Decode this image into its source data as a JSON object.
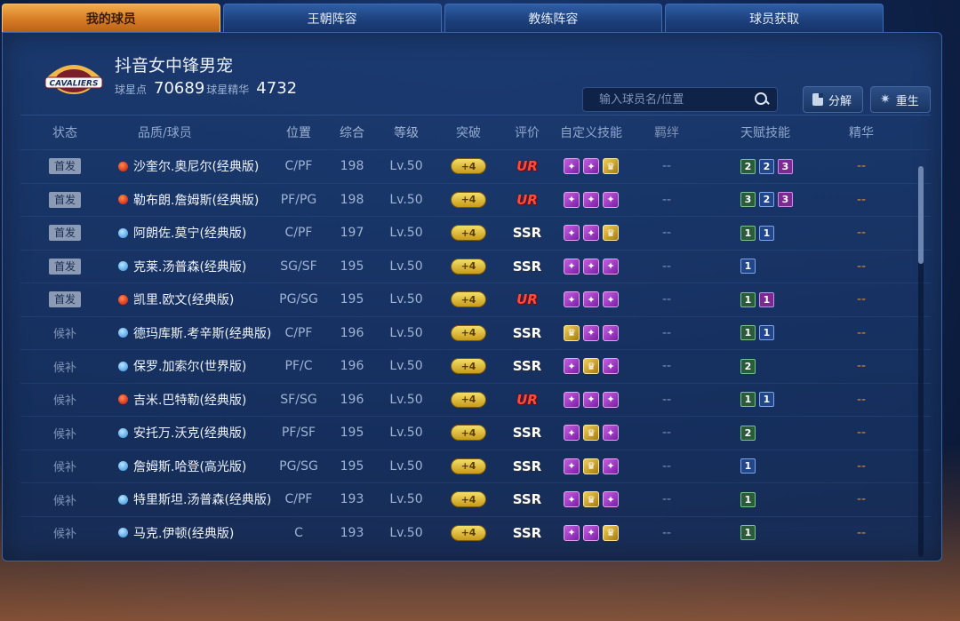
{
  "tabs": [
    {
      "label": "我的球员",
      "active": true
    },
    {
      "label": "王朝阵容",
      "active": false
    },
    {
      "label": "教练阵容",
      "active": false
    },
    {
      "label": "球员获取",
      "active": false
    }
  ],
  "team": {
    "logo_text": "CAVALIERS",
    "name": "抖音女中锋男宠",
    "points_label": "球星点",
    "points_value": "70689",
    "essence_label": "球星精华",
    "essence_value": "4732"
  },
  "search": {
    "placeholder": "输入球员名/位置"
  },
  "actions": {
    "decompose": "分解",
    "rebirth": "重生"
  },
  "columns": {
    "status": "状态",
    "player": "品质/球员",
    "position": "位置",
    "overall": "综合",
    "level": "等级",
    "breakthrough": "突破",
    "grade": "评价",
    "custom_skills": "自定义技能",
    "bond": "羁绊",
    "talent": "天赋技能",
    "essence": "精华"
  },
  "colors": {
    "active_tab": "#e08a2e",
    "ur_grade": "#ff4a3a",
    "essence": "#e28c2f"
  },
  "rows": [
    {
      "status": "首发",
      "starter": true,
      "rarity": "UR",
      "name": "沙奎尔.奥尼尔(经典版)",
      "position": "C/PF",
      "overall": "198",
      "level": "Lv.50",
      "breakthrough": "+4",
      "grade": "UR",
      "skills": [
        "purple",
        "purple",
        "gold"
      ],
      "bond": "--",
      "talent": [
        {
          "v": "2",
          "c": "green"
        },
        {
          "v": "2",
          "c": "blue"
        },
        {
          "v": "3",
          "c": "purple"
        }
      ],
      "essence": "--"
    },
    {
      "status": "首发",
      "starter": true,
      "rarity": "UR",
      "name": "勒布朗.詹姆斯(经典版)",
      "position": "PF/PG",
      "overall": "198",
      "level": "Lv.50",
      "breakthrough": "+4",
      "grade": "UR",
      "skills": [
        "purple",
        "purple",
        "purple"
      ],
      "bond": "--",
      "talent": [
        {
          "v": "3",
          "c": "green"
        },
        {
          "v": "2",
          "c": "blue"
        },
        {
          "v": "3",
          "c": "purple"
        }
      ],
      "essence": "--"
    },
    {
      "status": "首发",
      "starter": true,
      "rarity": "SSR",
      "name": "阿朗佐.莫宁(经典版)",
      "position": "C/PF",
      "overall": "197",
      "level": "Lv.50",
      "breakthrough": "+4",
      "grade": "SSR",
      "skills": [
        "purple",
        "purple",
        "gold"
      ],
      "bond": "--",
      "talent": [
        {
          "v": "1",
          "c": "green"
        },
        {
          "v": "1",
          "c": "blue"
        }
      ],
      "essence": "--"
    },
    {
      "status": "首发",
      "starter": true,
      "rarity": "SSR",
      "name": "克莱.汤普森(经典版)",
      "position": "SG/SF",
      "overall": "195",
      "level": "Lv.50",
      "breakthrough": "+4",
      "grade": "SSR",
      "skills": [
        "purple",
        "purple",
        "purple"
      ],
      "bond": "--",
      "talent": [
        {
          "v": "1",
          "c": "blue"
        }
      ],
      "essence": "--"
    },
    {
      "status": "首发",
      "starter": true,
      "rarity": "UR",
      "name": "凯里.欧文(经典版)",
      "position": "PG/SG",
      "overall": "195",
      "level": "Lv.50",
      "breakthrough": "+4",
      "grade": "UR",
      "skills": [
        "purple",
        "purple",
        "purple"
      ],
      "bond": "--",
      "talent": [
        {
          "v": "1",
          "c": "green"
        },
        {
          "v": "1",
          "c": "purple"
        }
      ],
      "essence": "--"
    },
    {
      "status": "候补",
      "starter": false,
      "rarity": "SSR",
      "name": "德玛库斯.考辛斯(经典版)",
      "position": "C/PF",
      "overall": "196",
      "level": "Lv.50",
      "breakthrough": "+4",
      "grade": "SSR",
      "skills": [
        "gold",
        "purple",
        "purple"
      ],
      "bond": "--",
      "talent": [
        {
          "v": "1",
          "c": "green"
        },
        {
          "v": "1",
          "c": "blue"
        }
      ],
      "essence": "--"
    },
    {
      "status": "候补",
      "starter": false,
      "rarity": "SSR",
      "name": "保罗.加索尔(世界版)",
      "position": "PF/C",
      "overall": "196",
      "level": "Lv.50",
      "breakthrough": "+4",
      "grade": "SSR",
      "skills": [
        "purple",
        "gold",
        "purple"
      ],
      "bond": "--",
      "talent": [
        {
          "v": "2",
          "c": "green"
        }
      ],
      "essence": "--"
    },
    {
      "status": "候补",
      "starter": false,
      "rarity": "UR",
      "name": "吉米.巴特勒(经典版)",
      "position": "SF/SG",
      "overall": "196",
      "level": "Lv.50",
      "breakthrough": "+4",
      "grade": "UR",
      "skills": [
        "purple",
        "purple",
        "purple"
      ],
      "bond": "--",
      "talent": [
        {
          "v": "1",
          "c": "green"
        },
        {
          "v": "1",
          "c": "blue"
        }
      ],
      "essence": "--"
    },
    {
      "status": "候补",
      "starter": false,
      "rarity": "SSR",
      "name": "安托万.沃克(经典版)",
      "position": "PF/SF",
      "overall": "195",
      "level": "Lv.50",
      "breakthrough": "+4",
      "grade": "SSR",
      "skills": [
        "purple",
        "gold",
        "purple"
      ],
      "bond": "--",
      "talent": [
        {
          "v": "2",
          "c": "green"
        }
      ],
      "essence": "--"
    },
    {
      "status": "候补",
      "starter": false,
      "rarity": "SSR",
      "name": "詹姆斯.哈登(高光版)",
      "position": "PG/SG",
      "overall": "195",
      "level": "Lv.50",
      "breakthrough": "+4",
      "grade": "SSR",
      "skills": [
        "purple",
        "gold",
        "purple"
      ],
      "bond": "--",
      "talent": [
        {
          "v": "1",
          "c": "blue"
        }
      ],
      "essence": "--"
    },
    {
      "status": "候补",
      "starter": false,
      "rarity": "SSR",
      "name": "特里斯坦.汤普森(经典版)",
      "position": "C/PF",
      "overall": "193",
      "level": "Lv.50",
      "breakthrough": "+4",
      "grade": "SSR",
      "skills": [
        "purple",
        "gold",
        "purple"
      ],
      "bond": "--",
      "talent": [
        {
          "v": "1",
          "c": "green"
        }
      ],
      "essence": "--"
    },
    {
      "status": "候补",
      "starter": false,
      "rarity": "SSR",
      "name": "马克.伊顿(经典版)",
      "position": "C",
      "overall": "193",
      "level": "Lv.50",
      "breakthrough": "+4",
      "grade": "SSR",
      "skills": [
        "purple",
        "purple",
        "gold"
      ],
      "bond": "--",
      "talent": [
        {
          "v": "1",
          "c": "green"
        }
      ],
      "essence": "--"
    }
  ]
}
